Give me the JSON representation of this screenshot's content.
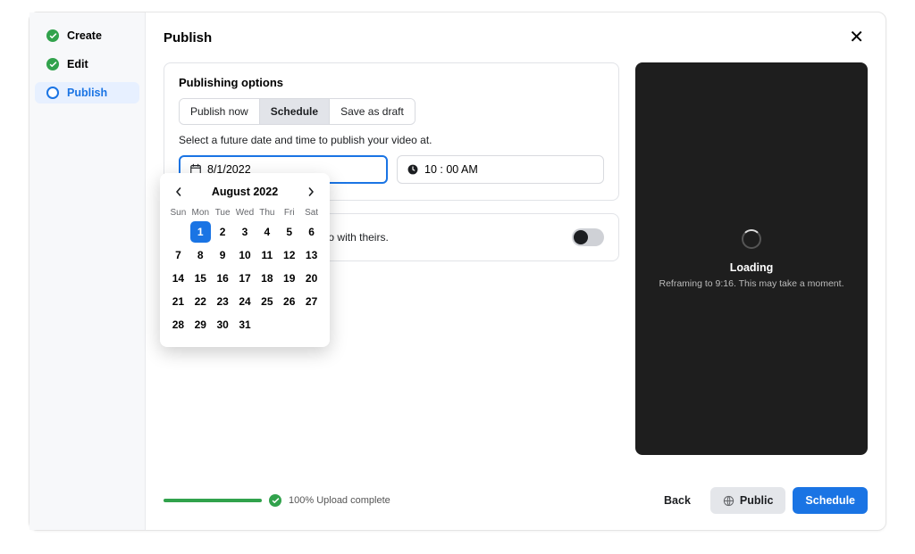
{
  "sidebar": {
    "steps": [
      {
        "label": "Create",
        "state": "done"
      },
      {
        "label": "Edit",
        "state": "done"
      },
      {
        "label": "Publish",
        "state": "current"
      }
    ]
  },
  "header": {
    "title": "Publish"
  },
  "publishing": {
    "card_title": "Publishing options",
    "tabs": {
      "now": "Publish now",
      "schedule": "Schedule",
      "draft": "Save as draft"
    },
    "hint": "Select a future date and time to publish your video at.",
    "date_value": "8/1/2022",
    "time_value": "10 : 00 AM"
  },
  "calendar": {
    "month_label": "August 2022",
    "dow": [
      "Sun",
      "Mon",
      "Tue",
      "Wed",
      "Thu",
      "Fri",
      "Sat"
    ],
    "days": [
      1,
      2,
      3,
      4,
      5,
      6,
      7,
      8,
      9,
      10,
      11,
      12,
      13,
      14,
      15,
      16,
      17,
      18,
      19,
      20,
      21,
      22,
      23,
      24,
      25,
      26,
      27,
      28,
      29,
      30,
      31
    ],
    "selected": 1,
    "lead_blank": 1
  },
  "remix": {
    "text": "reate a reel that plays your video with theirs."
  },
  "preview": {
    "loading_title": "Loading",
    "loading_sub": "Reframing to 9:16. This may take a moment."
  },
  "footer": {
    "upload_text": "100% Upload complete",
    "back": "Back",
    "public": "Public",
    "schedule": "Schedule"
  }
}
